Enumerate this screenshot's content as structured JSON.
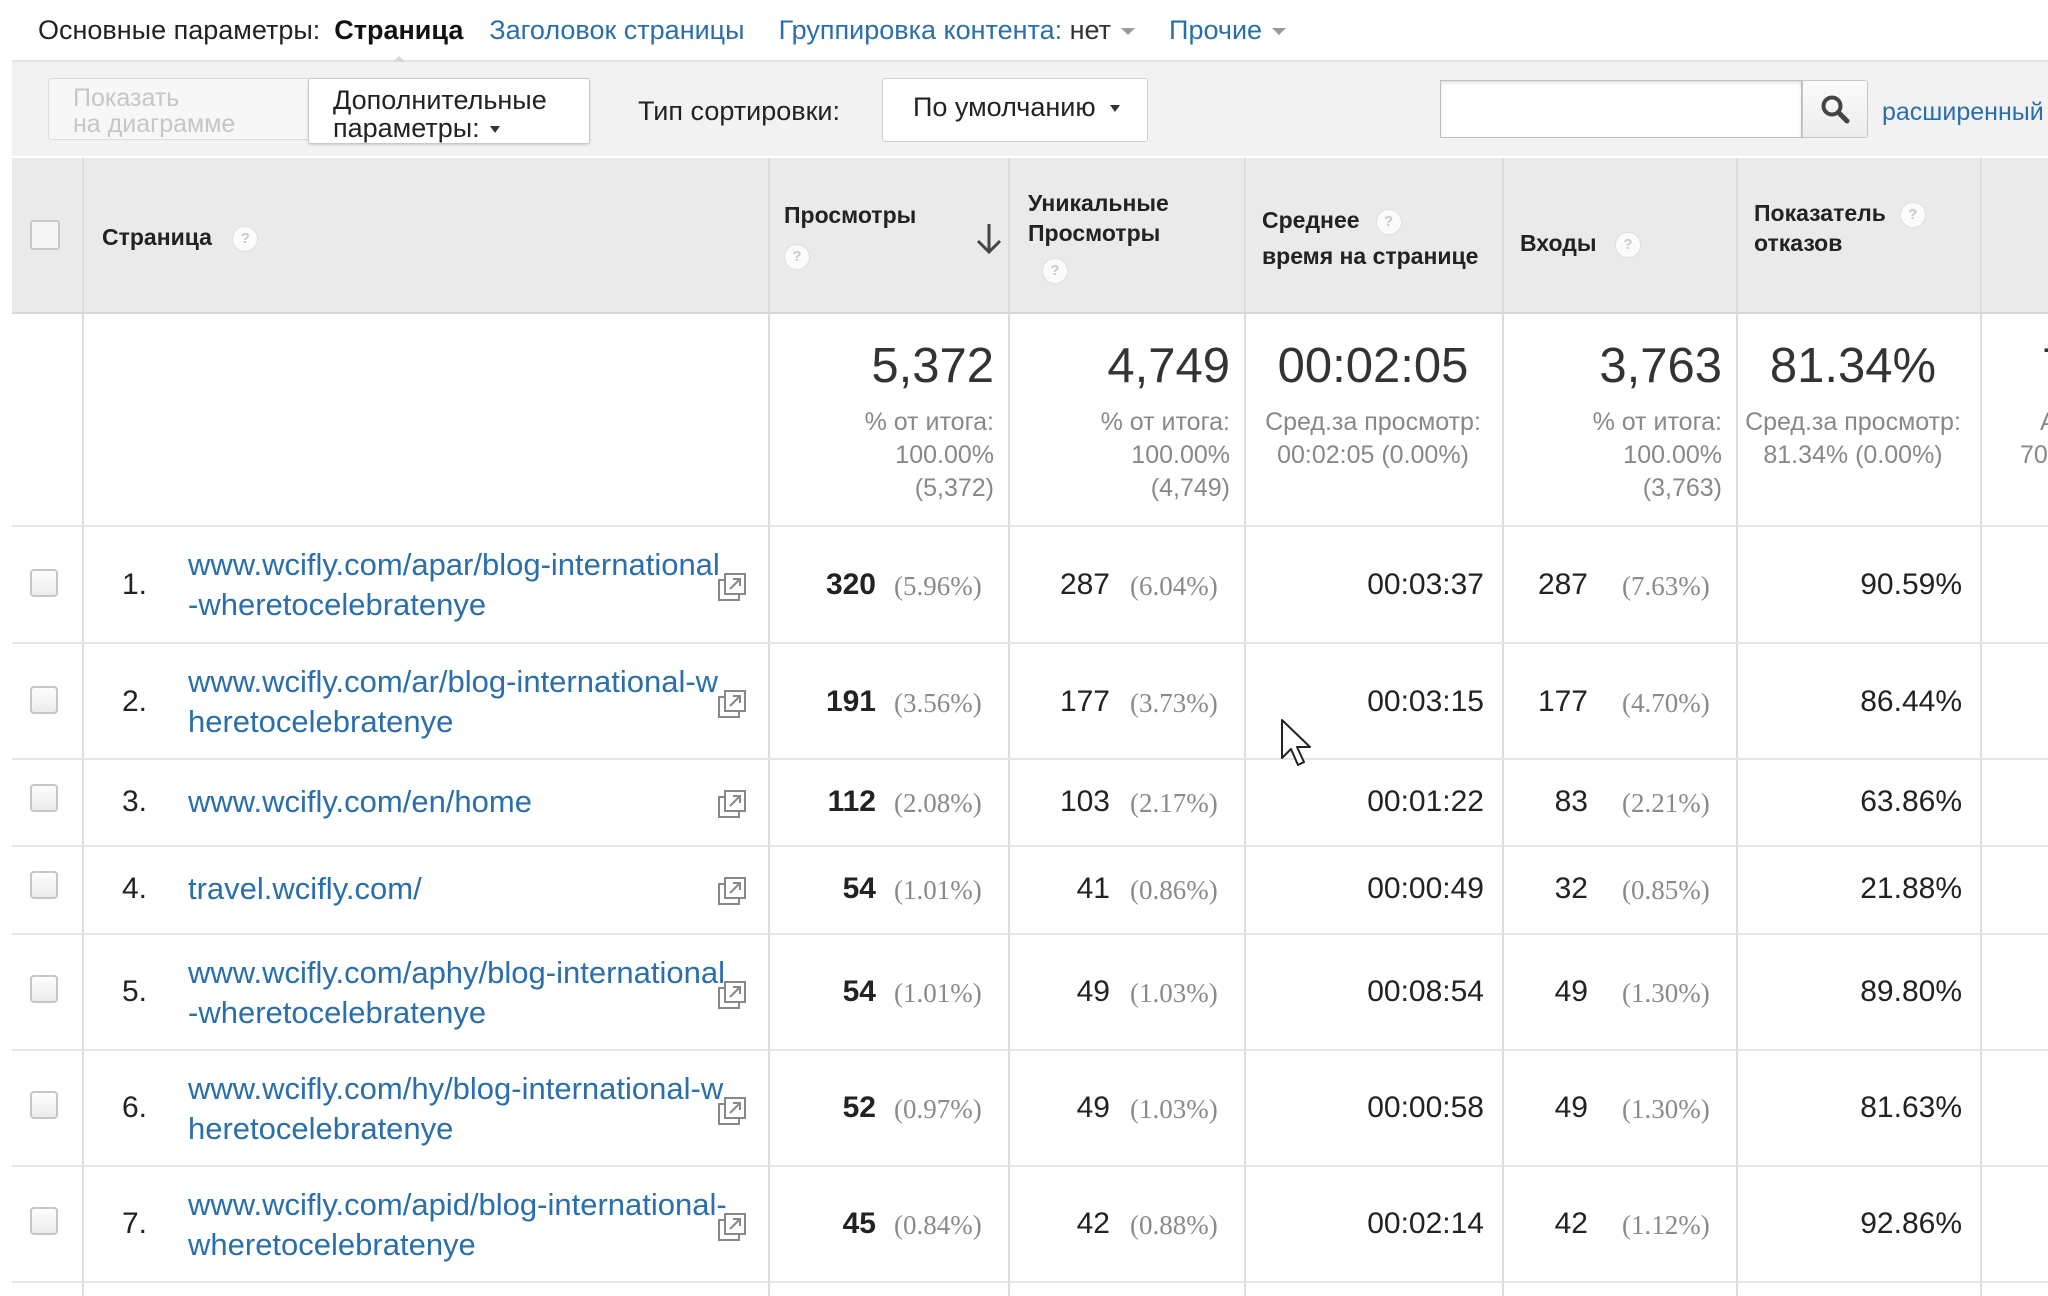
{
  "dimension_bar": {
    "label": "Основные параметры:",
    "active": "Страница",
    "page_title_link": "Заголовок страницы",
    "content_grouping_label": "Группировка контента:",
    "content_grouping_value": "нет",
    "other_label": "Прочие"
  },
  "toolbar": {
    "plot_rows_label_1": "Показать",
    "plot_rows_label_2": "на диаграмме",
    "secondary_dim_label_1": "Дополнительные",
    "secondary_dim_label_2": "параметры:",
    "sort_type_label": "Тип сортировки:",
    "sort_type_value": "По умолчанию",
    "search_value": "",
    "advanced_link": "расширенный"
  },
  "table": {
    "columns": {
      "page": "Страница",
      "pageviews": "Просмотры",
      "unique_1": "Уникальные",
      "unique_2": "Просмотры",
      "avgtime_1": "Среднее",
      "avgtime_2": "время на странице",
      "entrances": "Входы",
      "bounce_1": "Показатель",
      "bounce_2": "отказов"
    },
    "totals": {
      "pageviews": "5,372",
      "pageviews_sub_1": "% от итога:",
      "pageviews_sub_2": "100.00%",
      "pageviews_sub_3": "(5,372)",
      "unique": "4,749",
      "unique_sub_1": "% от итога:",
      "unique_sub_2": "100.00%",
      "unique_sub_3": "(4,749)",
      "avgtime": "00:02:05",
      "avgtime_sub_1": "Сред.за просмотр:",
      "avgtime_sub_2": "00:02:05 (0.00%)",
      "entrances": "3,763",
      "entrances_sub_1": "% от итога:",
      "entrances_sub_2": "100.00%",
      "entrances_sub_3": "(3,763)",
      "bounce": "81.34%",
      "bounce_sub_1": "Сред.за просмотр:",
      "bounce_sub_2": "81.34% (0.00%)",
      "cut_big": "7",
      "cut_sub_1": "А",
      "cut_sub_2": "70."
    },
    "rows": [
      {
        "index": "1.",
        "page": "www.wcifly.com/apar/blog-international-wheretocelebratenye",
        "pageviews": "320",
        "pageviews_pct": "(5.96%)",
        "unique": "287",
        "unique_pct": "(6.04%)",
        "avgtime": "00:03:37",
        "entrances": "287",
        "entrances_pct": "(7.63%)",
        "bounce": "90.59%"
      },
      {
        "index": "2.",
        "page": "www.wcifly.com/ar/blog-international-wheretocelebratenye",
        "pageviews": "191",
        "pageviews_pct": "(3.56%)",
        "unique": "177",
        "unique_pct": "(3.73%)",
        "avgtime": "00:03:15",
        "entrances": "177",
        "entrances_pct": "(4.70%)",
        "bounce": "86.44%"
      },
      {
        "index": "3.",
        "page": "www.wcifly.com/en/home",
        "pageviews": "112",
        "pageviews_pct": "(2.08%)",
        "unique": "103",
        "unique_pct": "(2.17%)",
        "avgtime": "00:01:22",
        "entrances": "83",
        "entrances_pct": "(2.21%)",
        "bounce": "63.86%"
      },
      {
        "index": "4.",
        "page": "travel.wcifly.com/",
        "pageviews": "54",
        "pageviews_pct": "(1.01%)",
        "unique": "41",
        "unique_pct": "(0.86%)",
        "avgtime": "00:00:49",
        "entrances": "32",
        "entrances_pct": "(0.85%)",
        "bounce": "21.88%"
      },
      {
        "index": "5.",
        "page": "www.wcifly.com/aphy/blog-international-wheretocelebratenye",
        "pageviews": "54",
        "pageviews_pct": "(1.01%)",
        "unique": "49",
        "unique_pct": "(1.03%)",
        "avgtime": "00:08:54",
        "entrances": "49",
        "entrances_pct": "(1.30%)",
        "bounce": "89.80%"
      },
      {
        "index": "6.",
        "page": "www.wcifly.com/hy/blog-international-wheretocelebratenye",
        "pageviews": "52",
        "pageviews_pct": "(0.97%)",
        "unique": "49",
        "unique_pct": "(1.03%)",
        "avgtime": "00:00:58",
        "entrances": "49",
        "entrances_pct": "(1.30%)",
        "bounce": "81.63%"
      },
      {
        "index": "7.",
        "page": "www.wcifly.com/apid/blog-international-wheretocelebratenye",
        "pageviews": "45",
        "pageviews_pct": "(0.84%)",
        "unique": "42",
        "unique_pct": "(0.88%)",
        "avgtime": "00:02:14",
        "entrances": "42",
        "entrances_pct": "(1.12%)",
        "bounce": "92.86%"
      }
    ]
  }
}
